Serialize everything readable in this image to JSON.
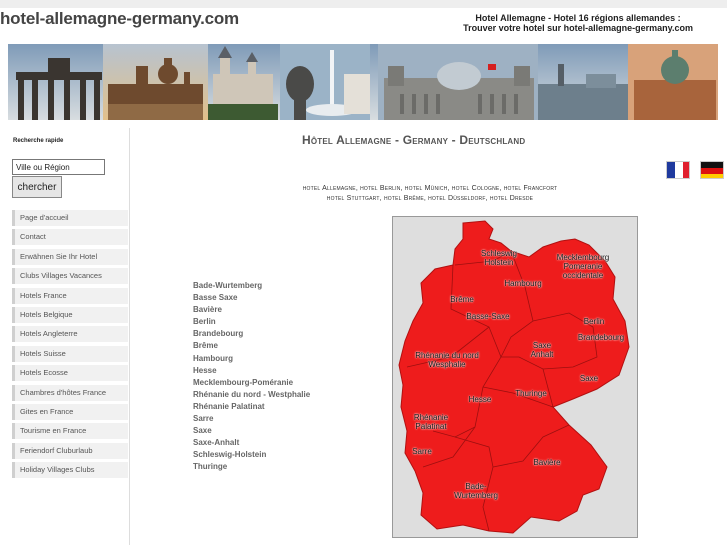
{
  "header": {
    "site_title": "hotel-allemagne-germany.com",
    "tagline_1": "Hotel Allemagne - Hotel 16 régions allemandes :",
    "tagline_2": "Trouver votre hotel sur hotel-allemagne-germany.com"
  },
  "sidebar": {
    "search_label": "Recherche rapide",
    "search_value": "Ville ou Région",
    "search_button": "chercher",
    "menu": [
      "Page d'accueil",
      "Contact",
      "Erwähnen Sie Ihr Hotel",
      "Clubs Villages Vacances",
      "Hotels France",
      "Hotels Belgique",
      "Hotels Angleterre",
      "Hotels Suisse",
      "Hotels Ecosse",
      "Chambres d'hôtes France",
      "Gites en France",
      "Tourisme en France",
      "Feriendorf Cluburlaub",
      "Holiday Villages Clubs"
    ]
  },
  "main": {
    "heading": "Hôtel Allemagne - Germany - Deutschland",
    "hotels_line_1": "hotel Allemagne, hotel Berlin, hotel Münich, hotel Cologne, hotel Francfort",
    "hotels_line_2": "hotel Stuttgart, hotel Brême, hotel Düsseldorf, hotel Dresde",
    "regions": [
      "Bade-Wurtemberg",
      "Basse Saxe",
      "Bavière",
      "Berlin",
      "Brandebourg",
      "Brême",
      "Hambourg",
      "Hesse",
      "Mecklembourg-Poméranie",
      "Rhénanie du nord - Westphalie",
      "Rhénanie Palatinat",
      "Sarre",
      "Saxe",
      "Saxe-Anhalt",
      "Schleswig-Holstein",
      "Thuringe"
    ],
    "map_labels": {
      "schleswig_1": "Schleswig",
      "schleswig_2": "Holstein",
      "mecklembourg_1": "Mecklembourg",
      "mecklembourg_2": "Pomeranie",
      "mecklembourg_3": "occidentale",
      "hambourg": "Hambourg",
      "breme": "Brême",
      "basse_saxe": "Basse-Saxe",
      "berlin": "Berlin",
      "brandebourg": "Brandebourg",
      "saxe_anhalt_1": "Saxe",
      "saxe_anhalt_2": "Anhalt",
      "rhenanie_nord_1": "Rhénanie du nord",
      "rhenanie_nord_2": "Wesphalie",
      "saxe": "Saxe",
      "hesse": "Hesse",
      "thuringe": "Thuringe",
      "rhenanie_pal_1": "Rhénanie",
      "rhenanie_pal_2": "Palatinat",
      "sarre": "Sarre",
      "baviere": "Bavière",
      "bade_1": "Bade-",
      "bade_2": "Wurtemberg"
    }
  },
  "colors": {
    "map_fill": "#ee1c1c",
    "map_background": "#dedede",
    "heading": "#555555"
  },
  "icons": [
    "french-flag-icon",
    "german-flag-icon"
  ]
}
